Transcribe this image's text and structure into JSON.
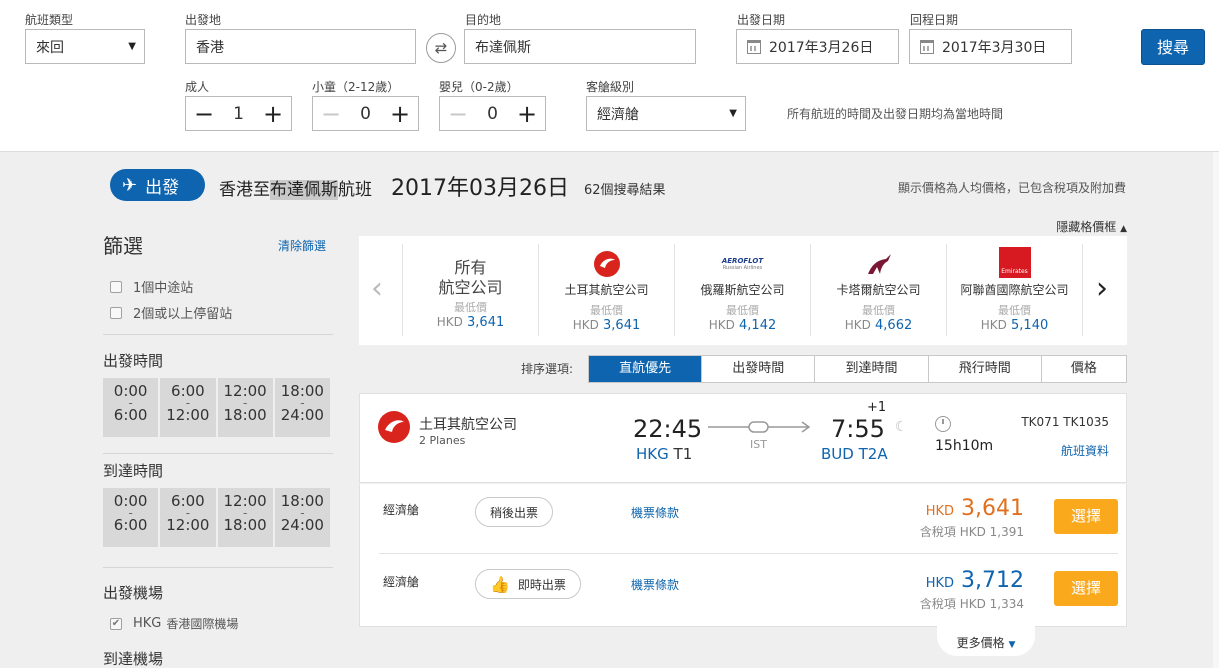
{
  "search": {
    "trip_type_label": "航班類型",
    "trip_type_value": "來回",
    "from_label": "出發地",
    "from_value": "香港",
    "to_label": "目的地",
    "to_value": "布達佩斯",
    "depart_label": "出發日期",
    "depart_value": "2017年3月26日",
    "return_label": "回程日期",
    "return_value": "2017年3月30日",
    "search_button": "搜尋",
    "adults_label": "成人",
    "adults_value": "1",
    "children_label": "小童（2-12歲）",
    "children_value": "0",
    "infants_label": "嬰兒（0-2歲）",
    "infants_value": "0",
    "cabin_label": "客艙級別",
    "cabin_value": "經濟艙",
    "local_time_note": "所有航班的時間及出發日期均為當地時間"
  },
  "header": {
    "depart_badge": "出發",
    "route_prefix": "香港至",
    "route_highlight": "布達佩斯",
    "route_suffix": "航班",
    "date": "2017年03月26日",
    "results": "62個搜尋結果",
    "price_note": "顯示價格為人均價格，已包含稅項及附加費",
    "hide_grid": "隱藏格價框"
  },
  "filters": {
    "title": "篩選",
    "clear": "清除篩選",
    "stops": [
      "1個中途站",
      "2個或以上停留站"
    ],
    "depart_time_title": "出發時間",
    "arrive_time_title": "到達時間",
    "time_slots": [
      {
        "from": "0:00",
        "to": "6:00"
      },
      {
        "from": "6:00",
        "to": "12:00"
      },
      {
        "from": "12:00",
        "to": "18:00"
      },
      {
        "from": "18:00",
        "to": "24:00"
      }
    ],
    "dash": "-",
    "depart_airport_title": "出發機場",
    "depart_airport_code": "HKG",
    "depart_airport_name": "香港國際機場",
    "arrive_airport_title": "到達機場"
  },
  "carousel": {
    "low_label": "最低價",
    "currency": "HKD",
    "all_line1": "所有",
    "all_line2": "航空公司",
    "all_price": "3,641",
    "airlines": [
      {
        "name": "土耳其航空公司",
        "price": "3,641",
        "icon": "turkish-airlines-logo"
      },
      {
        "name": "俄羅斯航空公司",
        "price": "4,142",
        "icon": "aeroflot-logo",
        "logo_text": "AEROFLOT",
        "logo_sub": "Russian Airlines"
      },
      {
        "name": "卡塔爾航空公司",
        "price": "4,662",
        "icon": "qatar-airways-logo"
      },
      {
        "name": "阿聯酋國際航空公司",
        "price": "5,140",
        "icon": "emirates-logo",
        "logo_text": "Emirates"
      }
    ]
  },
  "sort": {
    "label": "排序選項:",
    "options": [
      "直航優先",
      "出發時間",
      "到達時間",
      "飛行時間",
      "價格"
    ],
    "active_index": 0
  },
  "flight": {
    "airline": "土耳其航空公司",
    "planes": "2 Planes",
    "depart_time": "22:45",
    "depart_code": "HKG",
    "depart_terminal": "T1",
    "via": "IST",
    "arrive_time": "7:55",
    "day_offset": "+1",
    "arrive_code": "BUD",
    "arrive_terminal": "T2A",
    "duration": "15h10m",
    "flight_numbers": "TK071 TK1035",
    "info_link": "航班資料"
  },
  "fares": [
    {
      "class": "經濟艙",
      "ticket": "稍後出票",
      "instant": false,
      "terms": "機票條款",
      "currency": "HKD",
      "price": "3,641",
      "tax": "含稅項 HKD 1,391",
      "button": "選擇",
      "color": "orange"
    },
    {
      "class": "經濟艙",
      "ticket": "即時出票",
      "instant": true,
      "terms": "機票條款",
      "currency": "HKD",
      "price": "3,712",
      "tax": "含稅項 HKD 1,334",
      "button": "選擇",
      "color": "blue"
    }
  ],
  "more_prices": "更多價格",
  "colors": {
    "brand_blue": "#0e64ae",
    "orange_price": "#e0701f",
    "choose_button": "#f9a91b"
  }
}
